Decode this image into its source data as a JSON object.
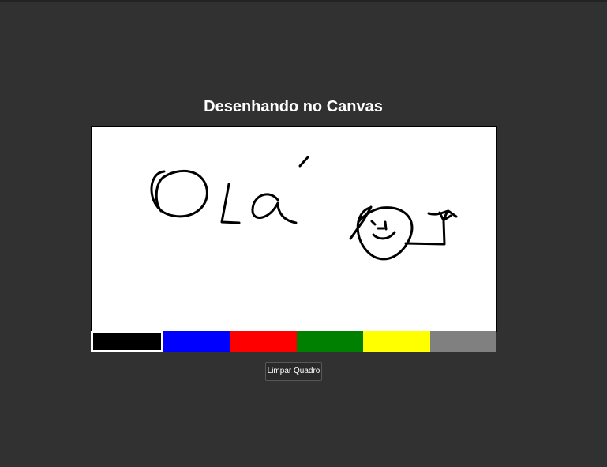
{
  "page": {
    "title": "Desenhando no Canvas"
  },
  "palette": {
    "selected_index": 0,
    "colors": [
      {
        "name": "black",
        "hex": "#000000"
      },
      {
        "name": "blue",
        "hex": "#0000ff"
      },
      {
        "name": "red",
        "hex": "#ff0000"
      },
      {
        "name": "green",
        "hex": "#008000"
      },
      {
        "name": "yellow",
        "hex": "#ffff00"
      },
      {
        "name": "gray",
        "hex": "#808080"
      }
    ]
  },
  "actions": {
    "clear_label": "Limpar Quadro"
  },
  "colors": {
    "background": "#313131",
    "canvas": "#ffffff",
    "ink": "#000000",
    "button_bg": "#2a2a2a"
  }
}
